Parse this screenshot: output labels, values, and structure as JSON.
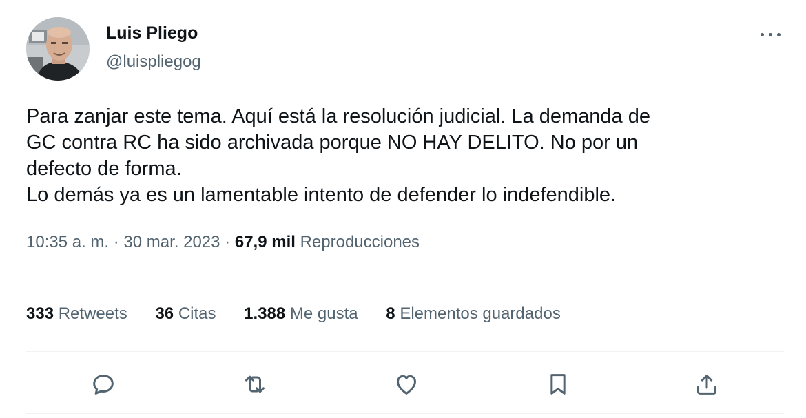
{
  "user": {
    "display_name": "Luis Pliego",
    "handle": "@luispliegog",
    "avatar_icon": "user-photo-avatar"
  },
  "menu": {
    "more_icon": "more-horizontal-icon"
  },
  "tweet": {
    "lines": [
      "Para zanjar este tema. Aquí está la resolución judicial. La demanda de",
      "GC contra RC ha sido archivada porque NO HAY DELITO. No por un",
      "defecto de forma.",
      "Lo demás ya es un lamentable intento de defender lo indefendible."
    ],
    "time": "10:35 a. m.",
    "separator": " · ",
    "date": "30 mar. 2023",
    "views_count": "67,9 mil",
    "views_label": "Reproducciones"
  },
  "stats": {
    "retweets": {
      "count": "333",
      "label": "Retweets"
    },
    "quotes": {
      "count": "36",
      "label": "Citas"
    },
    "likes": {
      "count": "1.388",
      "label": "Me gusta"
    },
    "bookmarks": {
      "count": "8",
      "label": "Elementos guardados"
    }
  },
  "actions": {
    "reply_icon": "reply-icon",
    "retweet_icon": "retweet-icon",
    "like_icon": "heart-icon",
    "bookmark_icon": "bookmark-icon",
    "share_icon": "share-icon"
  },
  "colors": {
    "text_primary": "#0f1419",
    "text_secondary": "#536471",
    "divider": "#eff3f4"
  }
}
